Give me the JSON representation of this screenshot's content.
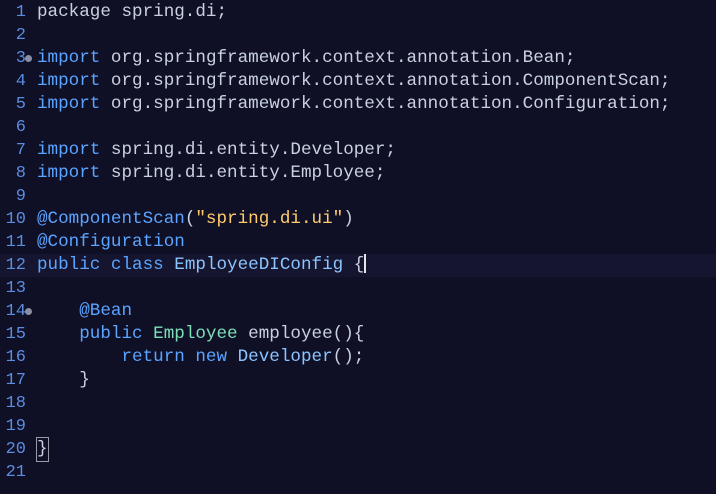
{
  "editor": {
    "lines": [
      {
        "n": "1",
        "tokens": [
          {
            "t": "package",
            "c": "id"
          },
          {
            "t": " spring.di;",
            "c": "id"
          }
        ]
      },
      {
        "n": "2",
        "tokens": []
      },
      {
        "n": "3",
        "fold": true,
        "tokens": [
          {
            "t": "import",
            "c": "kw"
          },
          {
            "t": " org.springframework.context.annotation.Bean;",
            "c": "id"
          }
        ]
      },
      {
        "n": "4",
        "tokens": [
          {
            "t": "import",
            "c": "kw"
          },
          {
            "t": " org.springframework.context.annotation.ComponentScan;",
            "c": "id"
          }
        ]
      },
      {
        "n": "5",
        "tokens": [
          {
            "t": "import",
            "c": "kw"
          },
          {
            "t": " org.springframework.context.annotation.Configuration;",
            "c": "id"
          }
        ]
      },
      {
        "n": "6",
        "tokens": []
      },
      {
        "n": "7",
        "tokens": [
          {
            "t": "import",
            "c": "kw"
          },
          {
            "t": " spring.di.entity.Developer;",
            "c": "id"
          }
        ]
      },
      {
        "n": "8",
        "tokens": [
          {
            "t": "import",
            "c": "kw"
          },
          {
            "t": " spring.di.entity.Employee;",
            "c": "id"
          }
        ]
      },
      {
        "n": "9",
        "tokens": []
      },
      {
        "n": "10",
        "tokens": [
          {
            "t": "@ComponentScan",
            "c": "ann"
          },
          {
            "t": "(",
            "c": "punct"
          },
          {
            "t": "\"spring.di.ui\"",
            "c": "str"
          },
          {
            "t": ")",
            "c": "punct"
          }
        ]
      },
      {
        "n": "11",
        "tokens": [
          {
            "t": "@Configuration",
            "c": "ann"
          }
        ]
      },
      {
        "n": "12",
        "current": true,
        "caret": true,
        "tokens": [
          {
            "t": "public class ",
            "c": "kw"
          },
          {
            "t": "EmployeeDIConfig",
            "c": "cls"
          },
          {
            "t": " {",
            "c": "punct"
          }
        ]
      },
      {
        "n": "13",
        "tokens": []
      },
      {
        "n": "14",
        "fold": true,
        "tokens": [
          {
            "t": "    @Bean",
            "c": "ann"
          }
        ]
      },
      {
        "n": "15",
        "tokens": [
          {
            "t": "    public ",
            "c": "kw"
          },
          {
            "t": "Employee",
            "c": "type"
          },
          {
            "t": " employee(){",
            "c": "id"
          }
        ]
      },
      {
        "n": "16",
        "tokens": [
          {
            "t": "        return new ",
            "c": "kw"
          },
          {
            "t": "Developer",
            "c": "cls"
          },
          {
            "t": "();",
            "c": "punct"
          }
        ]
      },
      {
        "n": "17",
        "tokens": [
          {
            "t": "    }",
            "c": "punct"
          }
        ]
      },
      {
        "n": "18",
        "tokens": []
      },
      {
        "n": "19",
        "tokens": []
      },
      {
        "n": "20",
        "boxBrace": true,
        "tokens": [
          {
            "t": "}",
            "c": "punct"
          }
        ]
      },
      {
        "n": "21",
        "tokens": []
      }
    ]
  }
}
